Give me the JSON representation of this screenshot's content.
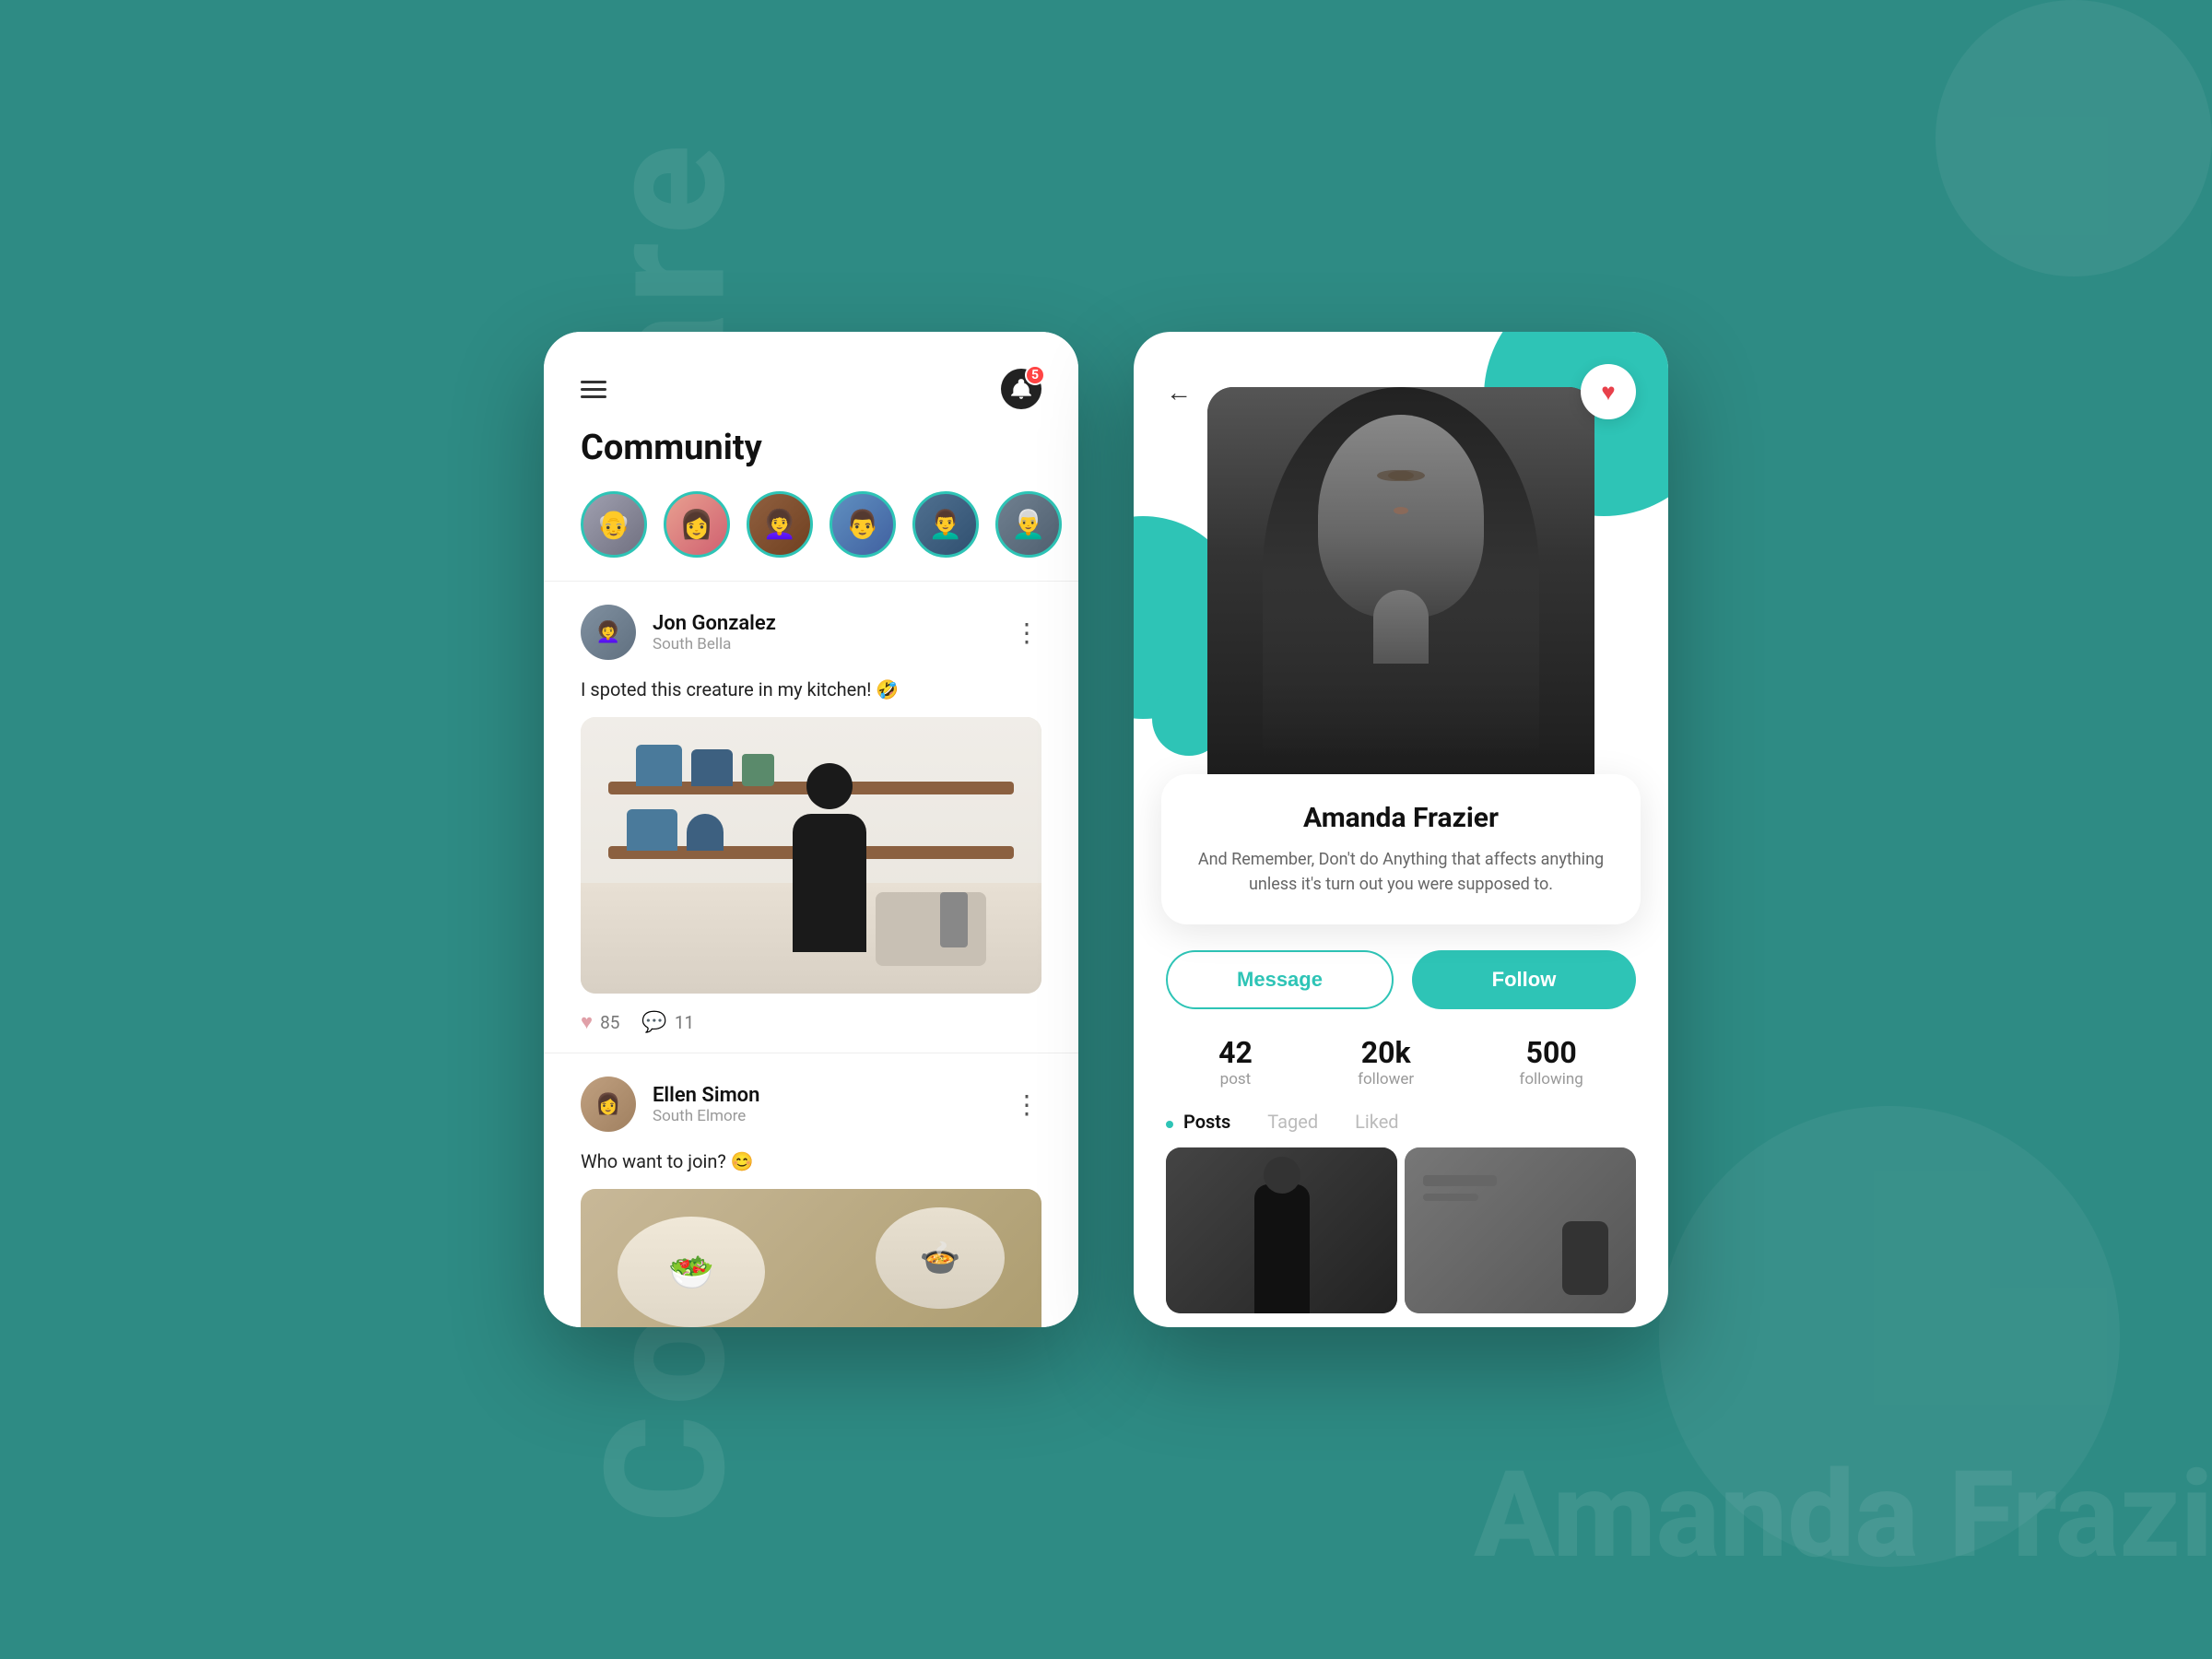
{
  "background": {
    "text_left": "Connect & Share",
    "text_right": "Amanda Frazier",
    "color": "#2e8b84"
  },
  "left_screen": {
    "title": "Community",
    "notification_badge": "5",
    "stories": [
      {
        "id": 1,
        "emoji": "👴"
      },
      {
        "id": 2,
        "emoji": "👩"
      },
      {
        "id": 3,
        "emoji": "👩‍🦱"
      },
      {
        "id": 4,
        "emoji": "👨"
      },
      {
        "id": 5,
        "emoji": "👨‍🦱"
      },
      {
        "id": 6,
        "emoji": "👨‍🦳"
      }
    ],
    "posts": [
      {
        "username": "Jon Gonzalez",
        "location": "South Bella",
        "text": "I spoted this creature in my kitchen! 🤣",
        "likes": "85",
        "comments": "11"
      },
      {
        "username": "Ellen Simon",
        "location": "South Elmore",
        "text": "Who want to join? 😊"
      }
    ]
  },
  "right_screen": {
    "profile_name": "Amanda Frazier",
    "profile_bio": "And Remember, Don't do Anything that affects anything unless it's turn out you were supposed to.",
    "stats": [
      {
        "number": "42",
        "label": "post"
      },
      {
        "number": "20k",
        "label": "follower"
      },
      {
        "number": "500",
        "label": "following"
      }
    ],
    "tabs": [
      "Posts",
      "Taged",
      "Liked"
    ],
    "active_tab": "Posts",
    "buttons": {
      "message": "Message",
      "follow": "Follow"
    }
  }
}
